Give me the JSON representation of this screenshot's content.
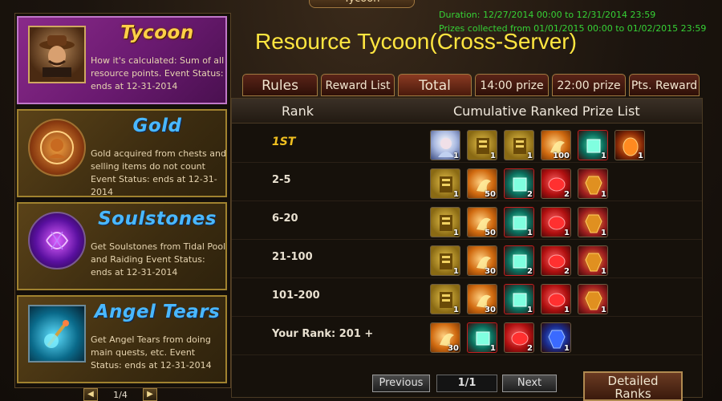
{
  "window": {
    "title": "Tycoon"
  },
  "header": {
    "duration": "Duration: 12/27/2014 00:00 to 12/31/2014 23:59",
    "prizes": "Prizes collected from 01/01/2015 00:00 to 01/02/2015 23:59",
    "title": "Resource Tycoon(Cross-Server)"
  },
  "sidebar": {
    "cards": [
      {
        "title": "Tycoon",
        "desc": "How it's calculated: Sum of all resource points. Event Status: ends at 12-31-2014",
        "portrait": "tycoon-portrait-icon"
      },
      {
        "title": "Gold",
        "desc": "Gold acquired from chests and selling items do not count Event Status: ends at 12-31-2014",
        "portrait": "gold-coin-icon"
      },
      {
        "title": "Soulstones",
        "desc": "Get Soulstones from Tidal Pool and Raiding Event Status: ends at 12-31-2014",
        "portrait": "soulstone-orb-icon"
      },
      {
        "title": "Angel Tears",
        "desc": "Get Angel Tears from doing main quests, etc. Event Status: ends at 12-31-2014",
        "portrait": "angel-tears-icon"
      }
    ],
    "pager": "1/4"
  },
  "tabs": [
    {
      "label": "Rules"
    },
    {
      "label": "Reward List"
    },
    {
      "label": "Total"
    },
    {
      "label": "14:00 prize"
    },
    {
      "label": "22:00 prize"
    },
    {
      "label": "Pts. Reward"
    }
  ],
  "table": {
    "col_rank": "Rank",
    "col_list": "Cumulative Ranked Prize List",
    "rows": [
      {
        "rank": "1ST",
        "items": [
          {
            "icon": "angel-portrait-icon",
            "qty": "1"
          },
          {
            "icon": "gold-scroll-icon",
            "qty": "1"
          },
          {
            "icon": "gold-scroll-icon",
            "qty": "1"
          },
          {
            "icon": "flame-scroll-icon",
            "qty": "100"
          },
          {
            "icon": "green-gem-icon",
            "qty": "1"
          },
          {
            "icon": "fire-egg-icon",
            "qty": "1"
          }
        ]
      },
      {
        "rank": "2-5",
        "items": [
          {
            "icon": "gold-scroll-icon",
            "qty": "1"
          },
          {
            "icon": "flame-scroll-icon",
            "qty": "50"
          },
          {
            "icon": "green-gem-icon",
            "qty": "2"
          },
          {
            "icon": "red-soulstone-icon",
            "qty": "2"
          },
          {
            "icon": "red-armor-icon",
            "qty": "1"
          }
        ]
      },
      {
        "rank": "6-20",
        "items": [
          {
            "icon": "gold-scroll-icon",
            "qty": "1"
          },
          {
            "icon": "flame-scroll-icon",
            "qty": "50"
          },
          {
            "icon": "green-gem-icon",
            "qty": "1"
          },
          {
            "icon": "red-soulstone-icon",
            "qty": "1"
          },
          {
            "icon": "red-armor-icon",
            "qty": "1"
          }
        ]
      },
      {
        "rank": "21-100",
        "items": [
          {
            "icon": "gold-scroll-icon",
            "qty": "1"
          },
          {
            "icon": "flame-scroll-icon",
            "qty": "30"
          },
          {
            "icon": "green-gem-icon",
            "qty": "2"
          },
          {
            "icon": "red-soulstone-icon",
            "qty": "2"
          },
          {
            "icon": "red-armor-icon",
            "qty": "1"
          }
        ]
      },
      {
        "rank": "101-200",
        "items": [
          {
            "icon": "gold-scroll-icon",
            "qty": "1"
          },
          {
            "icon": "flame-scroll-icon",
            "qty": "30"
          },
          {
            "icon": "green-gem-icon",
            "qty": "1"
          },
          {
            "icon": "red-soulstone-icon",
            "qty": "1"
          },
          {
            "icon": "red-armor-icon",
            "qty": "1"
          }
        ]
      },
      {
        "rank": "Your Rank: 201 +",
        "items": [
          {
            "icon": "flame-scroll-icon",
            "qty": "30"
          },
          {
            "icon": "green-gem-icon",
            "qty": "1"
          },
          {
            "icon": "red-soulstone-icon",
            "qty": "2"
          },
          {
            "icon": "blue-armor-icon",
            "qty": "1"
          }
        ]
      }
    ]
  },
  "footer": {
    "previous": "Previous",
    "page": "1/1",
    "next": "Next",
    "detailed_line1": "Detailed",
    "detailed_line2": "Ranks"
  },
  "colors": {
    "title_yellow": "#ffe640",
    "duration_green": "#36d236",
    "tycoon_card": "#8a2a8a",
    "rank_first": "#f0c020"
  }
}
